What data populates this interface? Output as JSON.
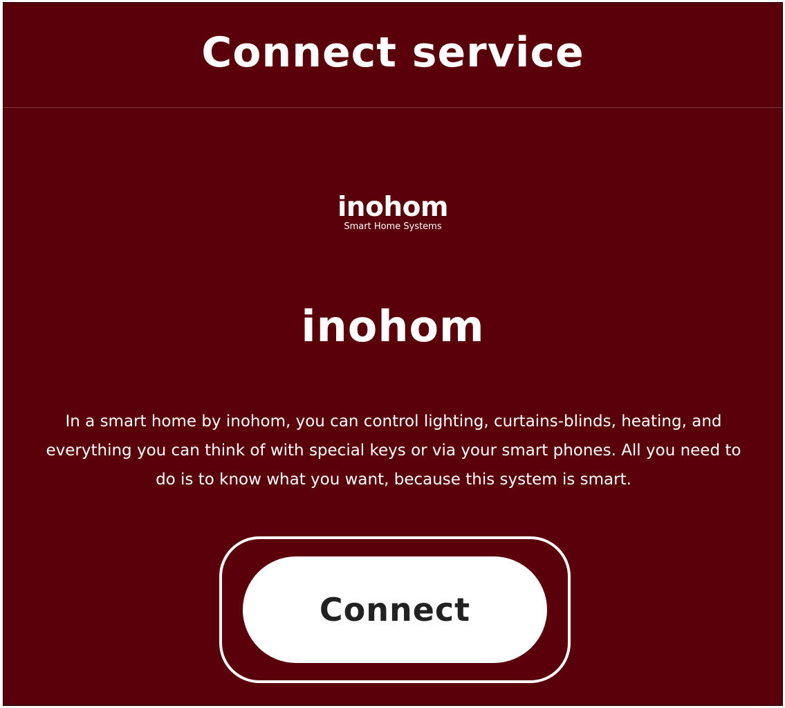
{
  "header": {
    "title": "Connect service"
  },
  "service": {
    "logo_text": "inohom",
    "logo_tagline": "Smart Home Systems",
    "name": "inohom",
    "description": "In a smart home by inohom, you can control lighting, curtains-blinds, heating, and everything you can think of with special keys or via your smart phones. All you need to do is to know what you want, because this system is smart."
  },
  "actions": {
    "connect_label": "Connect"
  },
  "colors": {
    "background": "#5a000a",
    "text": "#ffffff",
    "button_background": "#ffffff",
    "button_text": "#222222"
  }
}
